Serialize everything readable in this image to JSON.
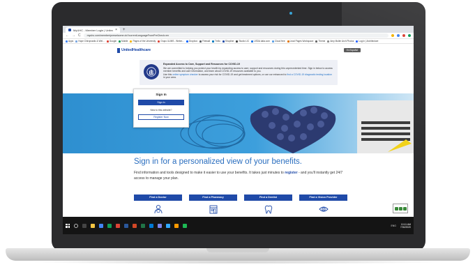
{
  "browser": {
    "tab_title": "MyUHC - Member Login | United...",
    "tab_close": "×",
    "new_tab": "+",
    "back": "←",
    "forward": "→",
    "reload": "C",
    "url": "myuhc.com/member/prewelcome.do?currentLanguageFromPreCheck=en",
    "bookmarks": [
      "Apps",
      "Hope Chiropractic & Wel...",
      "Google",
      "Mobile",
      "Pages of the University",
      "Grupo UUMS - Webm...",
      "Dropbox",
      "Firewall",
      "Trello",
      "Shopline",
      "Studio LIC",
      "USDA data.com",
      "Cloud free",
      "Lead Pages Workspace",
      "Theme",
      "Amy Muller Arch Photos",
      "Log in | Architecture"
    ]
  },
  "header": {
    "logo_text": "UnitedHealthcare",
    "language_button": "En Español"
  },
  "alert": {
    "title": "Expanded Access to Care, Support and Resources for COVID-19",
    "body_1": "We are committed to helping you protect your health by expanding access to care, support and resources during this unprecedented time. Sign in below to access member benefits and care information, and learn about COVID-19 resources available to you.",
    "body_2_pre": "Use this ",
    "body_2_link1": "online symptom checker",
    "body_2_mid": " to assess your risk for COVID-19 and get treatment options, or use our enhanced to ",
    "body_2_link2": "find a COVID-19 diagnostic testing location",
    "body_2_post": " in your area."
  },
  "signin": {
    "title": "Sign In",
    "signin_button": "Sign In",
    "new_text": "New to this website?",
    "register_button": "Register Now"
  },
  "main": {
    "headline": "Sign in for a personalized view of your benefits.",
    "sub_pre": "Find information and tools designed to make it easier to use your benefits. It takes just minutes to ",
    "sub_link": "register",
    "sub_post": " - and you'll instantly get 24/7 access to manage your plan."
  },
  "cards": [
    {
      "label": "Find a Doctor",
      "icon": "doctor-icon"
    },
    {
      "label": "Find a Pharmacy",
      "icon": "pharmacy-icon"
    },
    {
      "label": "Find a Dentist",
      "icon": "tooth-icon"
    },
    {
      "label": "Find a Vision Provider",
      "icon": "eye-icon"
    }
  ],
  "taskbar": {
    "time": "10:11 AM",
    "date": "7/30/2020",
    "tray": "ENG"
  },
  "colors": {
    "brand_blue": "#1f4aa8",
    "headline_blue": "#2a6ebf",
    "hero_blue": "#2b87c7"
  }
}
